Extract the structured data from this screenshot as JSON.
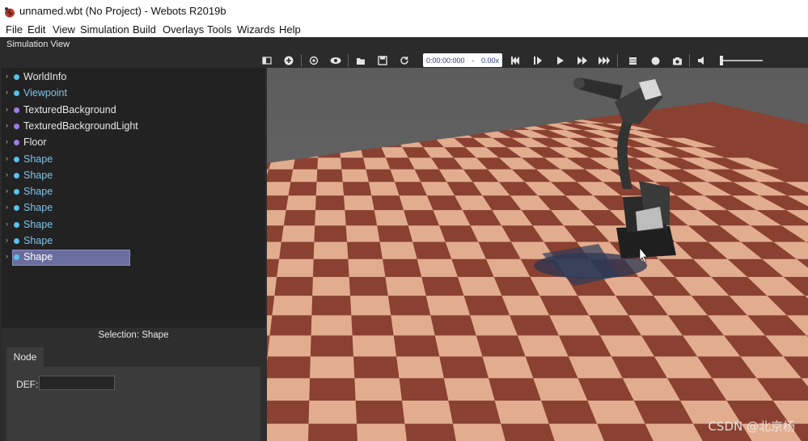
{
  "window": {
    "title": "unnamed.wbt (No Project) - Webots R2019b"
  },
  "menu": [
    "File",
    "Edit",
    "View",
    "Simulation",
    "Build",
    "Overlays",
    "Tools",
    "Wizards",
    "Help"
  ],
  "dock": {
    "title": "Simulation View"
  },
  "toolbar": {
    "time": "0:00:00:000",
    "speed_separator": "-",
    "speed": "0.00x",
    "icons": [
      "toggle-scene-tree-icon",
      "add-node-icon",
      "reset-view-icon",
      "show-hide-icon",
      "open-world-icon",
      "save-world-icon",
      "reload-world-icon",
      "reset-simulation-icon",
      "step-icon",
      "play-icon",
      "fast-forward-icon",
      "fastest-icon",
      "record-movie-icon",
      "record-animation-icon",
      "screenshot-icon",
      "mute-icon"
    ]
  },
  "scene_tree": {
    "items": [
      {
        "label": "WorldInfo",
        "dot": "#5bc0ea",
        "blue": false
      },
      {
        "label": "Viewpoint",
        "dot": "#5bc0ea",
        "blue": true
      },
      {
        "label": "TexturedBackground",
        "dot": "#9b7fe0",
        "blue": false
      },
      {
        "label": "TexturedBackgroundLight",
        "dot": "#9b7fe0",
        "blue": false
      },
      {
        "label": "Floor",
        "dot": "#9b7fe0",
        "blue": false
      },
      {
        "label": "Shape",
        "dot": "#5bc0ea",
        "blue": true
      },
      {
        "label": "Shape",
        "dot": "#5bc0ea",
        "blue": true
      },
      {
        "label": "Shape",
        "dot": "#5bc0ea",
        "blue": true
      },
      {
        "label": "Shape",
        "dot": "#5bc0ea",
        "blue": true
      },
      {
        "label": "Shape",
        "dot": "#5bc0ea",
        "blue": true
      },
      {
        "label": "Shape",
        "dot": "#5bc0ea",
        "blue": true
      },
      {
        "label": "Shape",
        "dot": "#5bc0ea",
        "blue": true,
        "selected": true
      }
    ]
  },
  "field_editor": {
    "selection": "Selection: Shape",
    "tab": "Node",
    "def_label": "DEF:",
    "def_value": ""
  },
  "watermark": "CSDN @北京杨"
}
